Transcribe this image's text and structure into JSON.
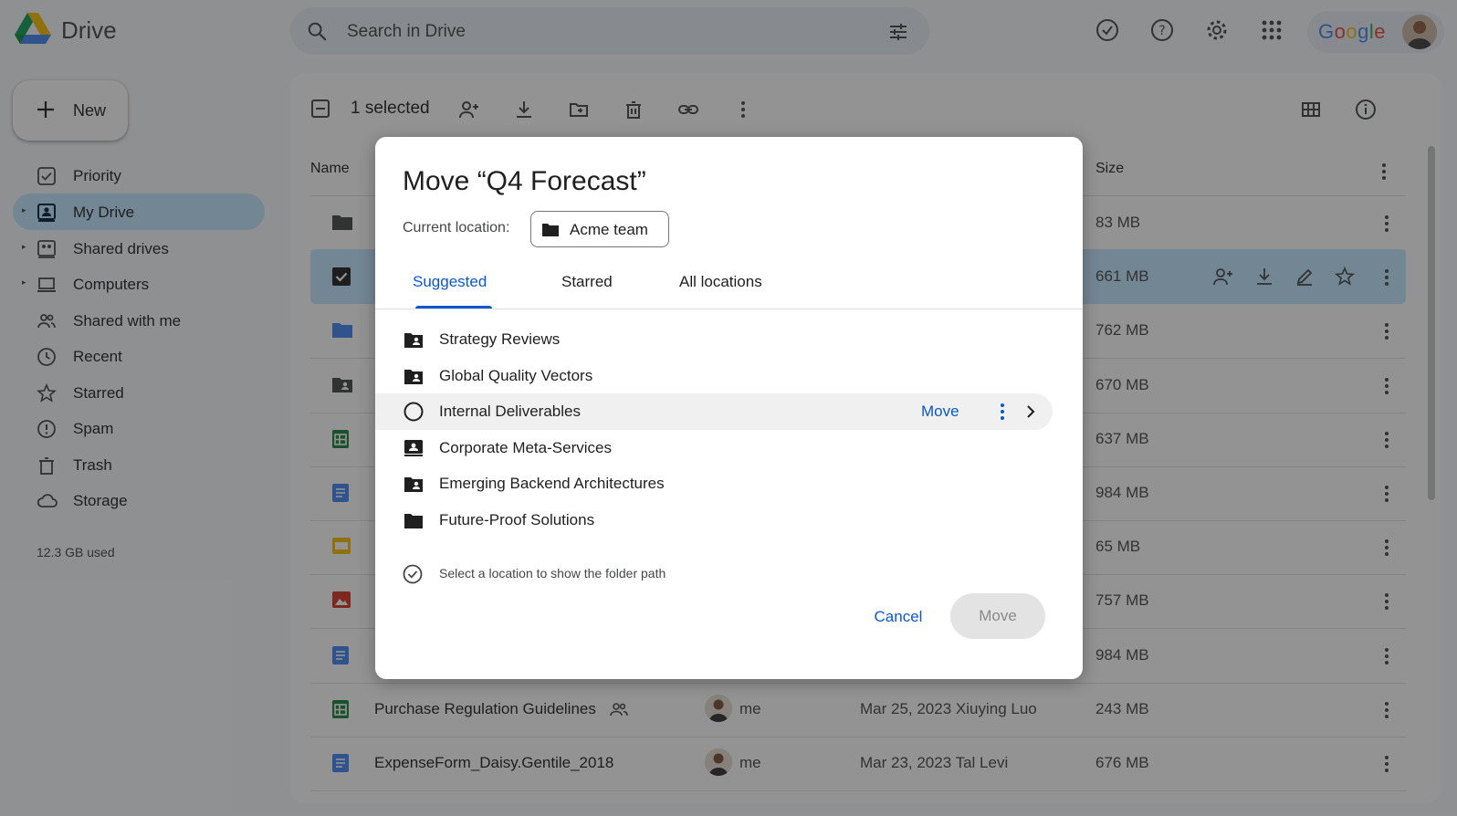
{
  "app": {
    "name": "Drive"
  },
  "header": {
    "search_placeholder": "Search in Drive",
    "account_brand": "Google"
  },
  "sidebar": {
    "new_label": "New",
    "items": [
      {
        "label": "Priority",
        "icon": "priority-icon",
        "expandable": false,
        "active": false
      },
      {
        "label": "My Drive",
        "icon": "my-drive-icon",
        "expandable": true,
        "active": true
      },
      {
        "label": "Shared drives",
        "icon": "shared-drives-icon",
        "expandable": true,
        "active": false
      },
      {
        "label": "Computers",
        "icon": "computer-icon",
        "expandable": true,
        "active": false
      },
      {
        "label": "Shared with me",
        "icon": "people-icon",
        "expandable": false,
        "active": false
      },
      {
        "label": "Recent",
        "icon": "clock-icon",
        "expandable": false,
        "active": false
      },
      {
        "label": "Starred",
        "icon": "star-icon",
        "expandable": false,
        "active": false
      },
      {
        "label": "Spam",
        "icon": "spam-icon",
        "expandable": false,
        "active": false
      },
      {
        "label": "Trash",
        "icon": "trash-icon",
        "expandable": false,
        "active": false
      },
      {
        "label": "Storage",
        "icon": "cloud-icon",
        "expandable": false,
        "active": false
      }
    ],
    "storage_used": "12.3 GB used"
  },
  "toolbar": {
    "selected_count": "1 selected"
  },
  "table": {
    "headers": {
      "name": "Name",
      "size": "Size"
    },
    "rows": [
      {
        "type": "folder",
        "name": "",
        "owner": "",
        "modified": "",
        "size": "83 MB",
        "shared": false,
        "selected": false
      },
      {
        "type": "selected",
        "name": "",
        "owner": "",
        "modified": "",
        "size": "661 MB",
        "shared": false,
        "selected": true
      },
      {
        "type": "folder-blue",
        "name": "",
        "owner": "",
        "modified": "",
        "size": "762 MB",
        "shared": false,
        "selected": false
      },
      {
        "type": "shared-folder",
        "name": "",
        "owner": "",
        "modified": "",
        "size": "670 MB",
        "shared": false,
        "selected": false
      },
      {
        "type": "sheet",
        "name": "",
        "owner": "",
        "modified": "",
        "size": "637 MB",
        "shared": false,
        "selected": false
      },
      {
        "type": "doc",
        "name": "",
        "owner": "",
        "modified": "",
        "size": "984 MB",
        "shared": false,
        "selected": false
      },
      {
        "type": "slides",
        "name": "",
        "owner": "",
        "modified": "",
        "size": "65 MB",
        "shared": false,
        "selected": false
      },
      {
        "type": "image",
        "name": "",
        "owner": "",
        "modified": "",
        "size": "757 MB",
        "shared": false,
        "selected": false
      },
      {
        "type": "doc",
        "name": "",
        "owner": "",
        "modified": "",
        "size": "984 MB",
        "shared": false,
        "selected": false
      },
      {
        "type": "sheet",
        "name": "Purchase Regulation Guidelines",
        "owner": "me",
        "modified": "Mar 25, 2023 Xiuying Luo",
        "size": "243 MB",
        "shared": true,
        "selected": false
      },
      {
        "type": "doc",
        "name": "ExpenseForm_Daisy.Gentile_2018",
        "owner": "me",
        "modified": "Mar 23, 2023 Tal Levi",
        "size": "676 MB",
        "shared": false,
        "selected": false
      }
    ]
  },
  "dialog": {
    "title": "Move “Q4 Forecast”",
    "current_location_label": "Current location:",
    "current_location": "Acme team",
    "tabs": [
      {
        "label": "Suggested",
        "active": true
      },
      {
        "label": "Starred",
        "active": false
      },
      {
        "label": "All locations",
        "active": false
      }
    ],
    "locations": [
      {
        "name": "Strategy Reviews",
        "icon": "shared-folder-icon",
        "hover": false
      },
      {
        "name": "Global Quality Vectors",
        "icon": "shared-folder-icon",
        "hover": false
      },
      {
        "name": "Internal Deliverables",
        "icon": "radio-icon",
        "hover": true
      },
      {
        "name": "Corporate Meta-Services",
        "icon": "shared-drive-icon",
        "hover": false
      },
      {
        "name": "Emerging Backend Architectures",
        "icon": "shared-folder-icon",
        "hover": false
      },
      {
        "name": "Future-Proof Solutions",
        "icon": "folder-icon",
        "hover": false
      }
    ],
    "row_move_label": "Move",
    "hint": "Select a location to show the folder path",
    "cancel_label": "Cancel",
    "move_label": "Move"
  },
  "colors": {
    "accent_blue": "#0b57d0",
    "selected_bg": "#c2e7ff",
    "sheets_green": "#188038",
    "docs_blue": "#4285f4",
    "slides_yellow": "#fbbc04",
    "image_red": "#d93025"
  }
}
